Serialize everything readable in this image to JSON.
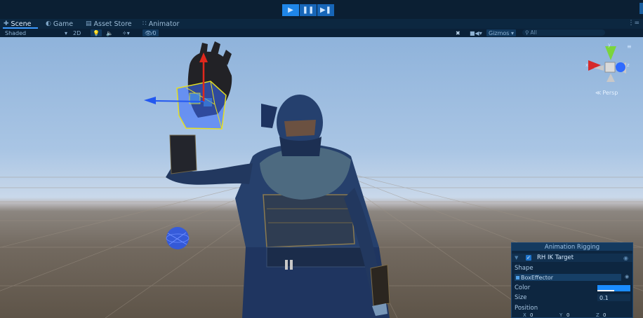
{
  "playbar": {
    "play_icon": "play-icon",
    "pause_icon": "pause-icon",
    "step_icon": "step-forward-icon"
  },
  "tabs": [
    {
      "label": "Scene",
      "icon": "scene-hash-icon"
    },
    {
      "label": "Game",
      "icon": "game-pacman-icon"
    },
    {
      "label": "Asset Store",
      "icon": "store-icon"
    },
    {
      "label": "Animator",
      "icon": "animator-icon"
    }
  ],
  "toolbar": {
    "shading_mode": "Shaded",
    "mode_2d": "2D",
    "layer_count": "0",
    "gizmos_label": "Gizmos",
    "search_placeholder": "All"
  },
  "scene_gizmo": {
    "axis_y": "y",
    "axis_x": "x",
    "axis_z": "z",
    "projection": "Persp"
  },
  "rig_panel": {
    "title": "Animation Rigging",
    "target_label": "RH IK Target",
    "shape_label": "Shape",
    "shape_value": "BoxEffector",
    "color_label": "Color",
    "size_label": "Size",
    "size_value": "0.1",
    "position_label": "Position",
    "pos_x_label": "X",
    "pos_x_value": "0",
    "pos_y_label": "Y",
    "pos_y_value": "0",
    "pos_z_label": "Z",
    "pos_z_value": "0"
  },
  "colors": {
    "accent": "#1f86e8",
    "swatch": "#1a8cff",
    "panel_bg": "#0d2640"
  }
}
